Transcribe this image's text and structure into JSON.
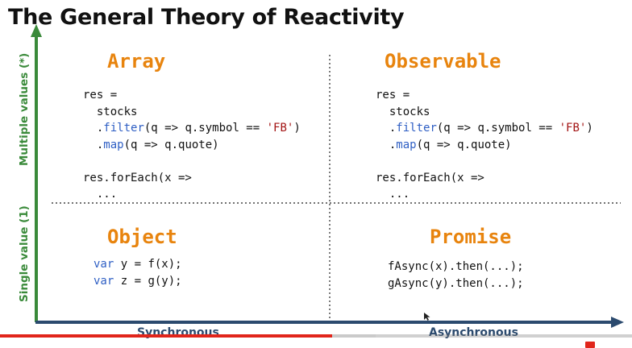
{
  "slide": {
    "title": "The General Theory of Reactivity",
    "y_axis": {
      "top_label": "Multiple values (*)",
      "bottom_label": "Single value (1)"
    },
    "x_axis": {
      "left_label": "Synchronous",
      "right_label": "Asynchronous"
    },
    "quadrants": {
      "array": {
        "title": "Array",
        "lines": [
          {
            "parts": [
              {
                "t": "res =",
                "c": "plain"
              }
            ]
          },
          {
            "parts": [
              {
                "t": "  stocks",
                "c": "plain"
              }
            ]
          },
          {
            "parts": [
              {
                "t": "  .",
                "c": "plain"
              },
              {
                "t": "filter",
                "c": "kw"
              },
              {
                "t": "(q => q.symbol == ",
                "c": "plain"
              },
              {
                "t": "'FB'",
                "c": "str"
              },
              {
                "t": ")",
                "c": "plain"
              }
            ]
          },
          {
            "parts": [
              {
                "t": "  .",
                "c": "plain"
              },
              {
                "t": "map",
                "c": "kw"
              },
              {
                "t": "(q => q.quote)",
                "c": "plain"
              }
            ]
          },
          {
            "parts": [
              {
                "t": "",
                "c": "plain"
              }
            ]
          },
          {
            "parts": [
              {
                "t": "res.forEach(x =>",
                "c": "plain"
              }
            ]
          },
          {
            "parts": [
              {
                "t": "  ...",
                "c": "plain"
              }
            ]
          }
        ]
      },
      "observable": {
        "title": "Observable",
        "lines": [
          {
            "parts": [
              {
                "t": "res =",
                "c": "plain"
              }
            ]
          },
          {
            "parts": [
              {
                "t": "  stocks",
                "c": "plain"
              }
            ]
          },
          {
            "parts": [
              {
                "t": "  .",
                "c": "plain"
              },
              {
                "t": "filter",
                "c": "kw"
              },
              {
                "t": "(q => q.symbol == ",
                "c": "plain"
              },
              {
                "t": "'FB'",
                "c": "str"
              },
              {
                "t": ")",
                "c": "plain"
              }
            ]
          },
          {
            "parts": [
              {
                "t": "  .",
                "c": "plain"
              },
              {
                "t": "map",
                "c": "kw"
              },
              {
                "t": "(q => q.quote)",
                "c": "plain"
              }
            ]
          },
          {
            "parts": [
              {
                "t": "",
                "c": "plain"
              }
            ]
          },
          {
            "parts": [
              {
                "t": "res.forEach(x =>",
                "c": "plain"
              }
            ]
          },
          {
            "parts": [
              {
                "t": "  ...",
                "c": "plain"
              }
            ]
          }
        ]
      },
      "object": {
        "title": "Object",
        "lines": [
          {
            "parts": [
              {
                "t": "var",
                "c": "kw"
              },
              {
                "t": " y = f(x);",
                "c": "plain"
              }
            ]
          },
          {
            "parts": [
              {
                "t": "var",
                "c": "kw"
              },
              {
                "t": " z = g(y);",
                "c": "plain"
              }
            ]
          }
        ]
      },
      "promise": {
        "title": "Promise",
        "lines": [
          {
            "parts": [
              {
                "t": "fAsync(x).then(...);",
                "c": "plain"
              }
            ]
          },
          {
            "parts": [
              {
                "t": "gAsync(y).then(...);",
                "c": "plain"
              }
            ]
          }
        ]
      }
    }
  },
  "player": {
    "played_fraction": 0.525,
    "buffered_fraction": 0.595
  },
  "colors": {
    "title": "#111111",
    "quad_title": "#e8840e",
    "keyword": "#2f5fc4",
    "string": "#a31515",
    "y_axis": "#3a8a3a",
    "x_axis": "#2b4a6e",
    "progress_played": "#e1251b"
  },
  "icons": {
    "cursor": "mouse-pointer-icon",
    "hd_badge": "hd-badge-icon"
  }
}
